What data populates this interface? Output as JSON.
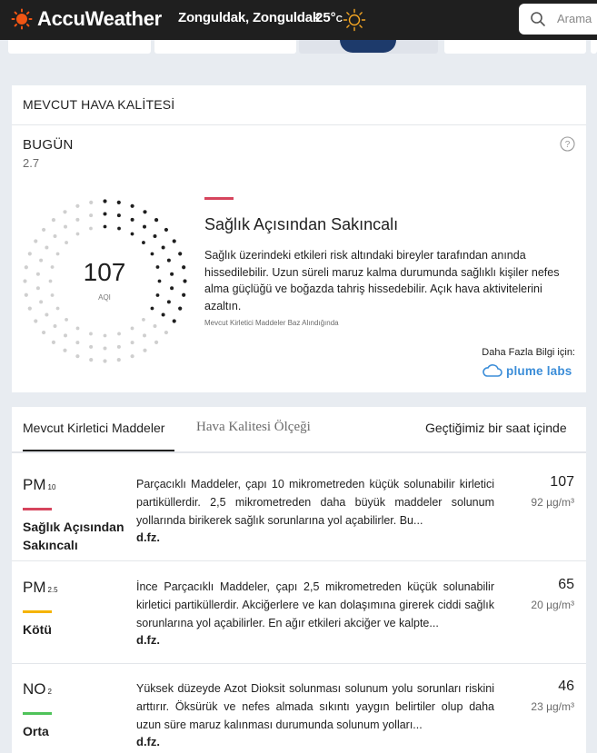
{
  "header": {
    "brand": "AccuWeather",
    "location": "Zonguldak, Zonguldak",
    "temperature": "25°",
    "temp_unit": "C",
    "weather_icon": "sun-icon",
    "search_placeholder": "Arama"
  },
  "air_quality": {
    "section_title": "MEVCUT HAVA KALİTESİ",
    "day_label": "BUGÜN",
    "date": "2.7",
    "aqi_value": "107",
    "aqi_label": "AQI",
    "aqi_fraction": 0.36,
    "category_title": "Sağlık Açısından Sakıncalı",
    "category_color": "#d6455d",
    "description": "Sağlık üzerindeki etkileri risk altındaki bireyler tarafından anında hissedilebilir. Uzun süreli maruz kalma durumunda sağlıklı kişiler nefes alma güçlüğü ve boğazda tahriş hissedebilir. Açık hava aktivitelerini azaltın.",
    "note": "Mevcut Kirletici Maddeler Baz Alındığında",
    "more_info": "Daha Fazla Bilgi için:",
    "partner": "plume labs",
    "partner_color": "#3b8dd8"
  },
  "pollutants": {
    "tabs": [
      {
        "label": "Mevcut Kirletici Maddeler"
      },
      {
        "label": "Hava Kalitesi Ölçeği"
      }
    ],
    "period": "Geçtiğimiz bir saat içinde",
    "items": [
      {
        "name": "PM",
        "sub": "10",
        "category": "Sağlık Açısından Sakıncalı",
        "color": "#d6455d",
        "description": "Parçacıklı Maddeler, çapı 10 mikrometreden küçük solunabilir kirletici partiküllerdir. 2,5 mikrometreden daha büyük maddeler solunum yollarında birikerek sağlık sorunlarına yol açabilirler. Bu...",
        "more": "d.fz.",
        "aqi": "107",
        "concentration": "92 µg/m³"
      },
      {
        "name": "PM",
        "sub": "2.5",
        "category": "Kötü",
        "color": "#f5b400",
        "description": "İnce Parçacıklı Maddeler, çapı 2,5 mikrometreden küçük solunabilir kirletici partiküllerdir. Akciğerlere ve kan dolaşımına girerek ciddi sağlık sorunlarına yol açabilirler. En ağır etkileri akciğer ve kalpte...",
        "more": "d.fz.",
        "aqi": "65",
        "concentration": "20 µg/m³"
      },
      {
        "name": "NO",
        "sub": "2",
        "category": "Orta",
        "color": "#4fc35a",
        "description": "Yüksek düzeyde Azot Dioksit solunması solunum yolu sorunları riskini arttırır. Öksürük ve nefes almada sıkıntı yaygın belirtiler olup daha uzun süre maruz kalınması durumunda solunum yolları...",
        "more": "d.fz.",
        "aqi": "46",
        "concentration": "23 µg/m³"
      }
    ]
  }
}
